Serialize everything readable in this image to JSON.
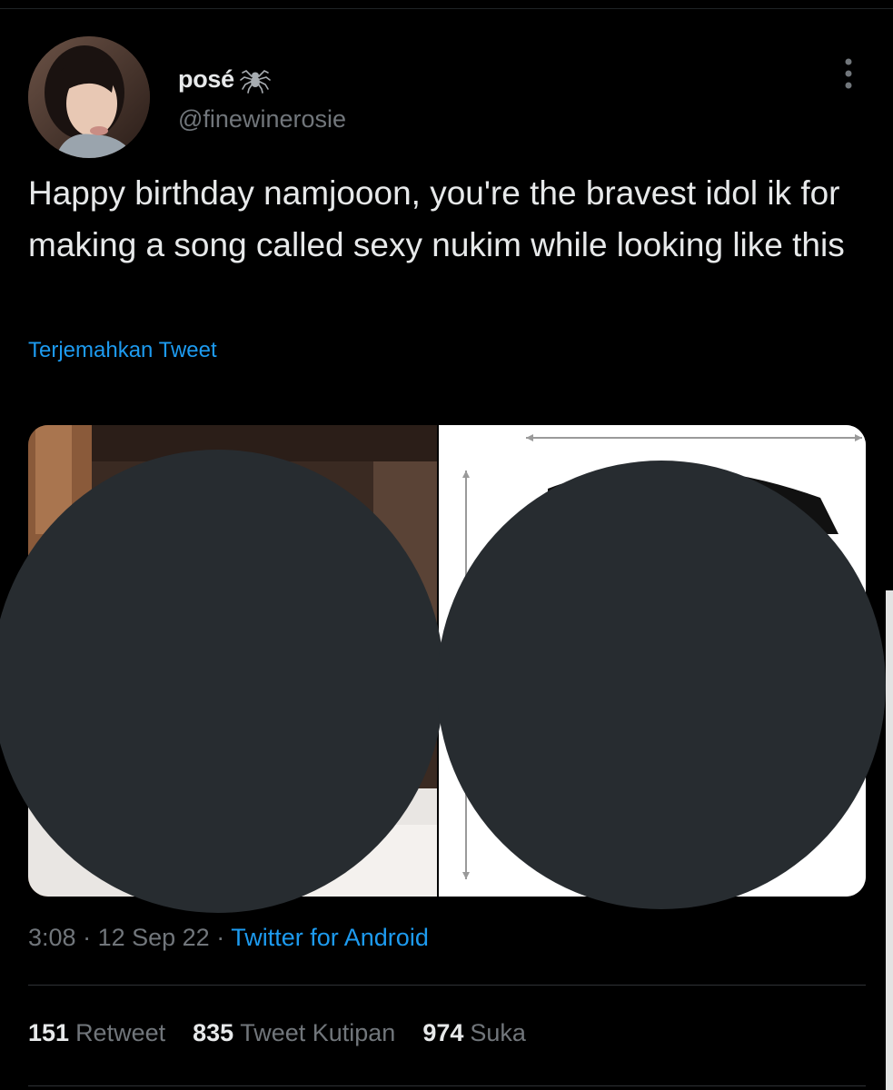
{
  "tweet": {
    "author": {
      "display_name": "posé",
      "handle": "@finewinerosie",
      "badge_icon": "spider-icon"
    },
    "text": "Happy birthday namjooon, you're the bravest idol ik for making a song called sexy nukim while looking like this",
    "translate_label": "Terjemahkan Tweet",
    "media": {
      "count": 2,
      "content": "redacted"
    },
    "meta": {
      "time": "3:08",
      "separator": "·",
      "date": "12 Sep 22",
      "source": "Twitter for Android"
    },
    "stats": [
      {
        "count": "151",
        "label": "Retweet"
      },
      {
        "count": "835",
        "label": "Tweet Kutipan"
      },
      {
        "count": "974",
        "label": "Suka"
      }
    ]
  },
  "colors": {
    "background": "#000000",
    "text_primary": "#e7e9ea",
    "text_secondary": "#71767b",
    "accent": "#1d9bf0",
    "redaction": "#272c30",
    "divider": "#2f3336"
  },
  "icons": {
    "more": "more-vertical-icon",
    "badge": "spider-icon"
  }
}
